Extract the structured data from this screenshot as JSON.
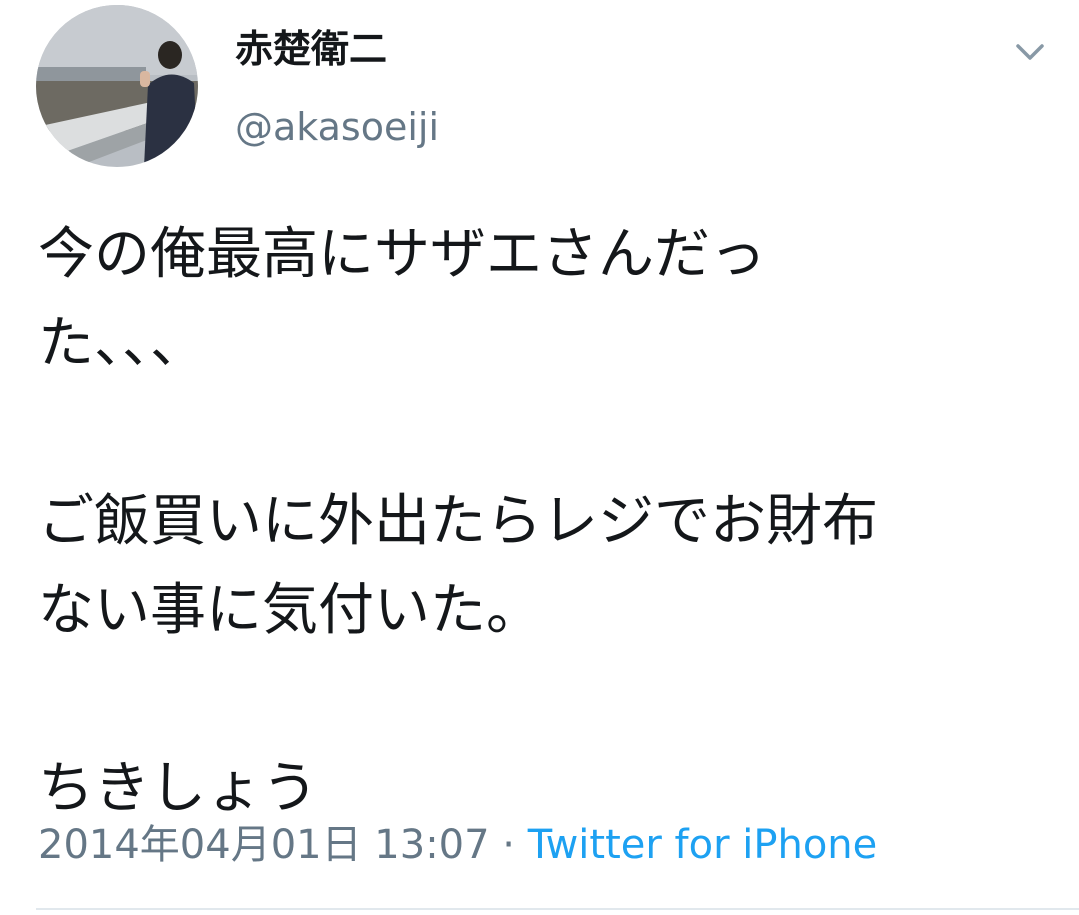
{
  "tweet": {
    "display_name": "赤楚衛二",
    "handle": "@akasoeiji",
    "body": "今の俺最高にサザエさんだっ\nた、、、\n\nご飯買いに外出たらレジでお財布\nない事に気付いた。\n\nちきしょう",
    "timestamp": "2014年04月01日 13:07",
    "separator": " · ",
    "source": "Twitter for iPhone"
  },
  "icons": {
    "menu": "chevron-down-icon"
  },
  "colors": {
    "text": "#14171a",
    "secondary": "#657786",
    "link": "#1da1f2",
    "divider": "#e1e8ed"
  }
}
